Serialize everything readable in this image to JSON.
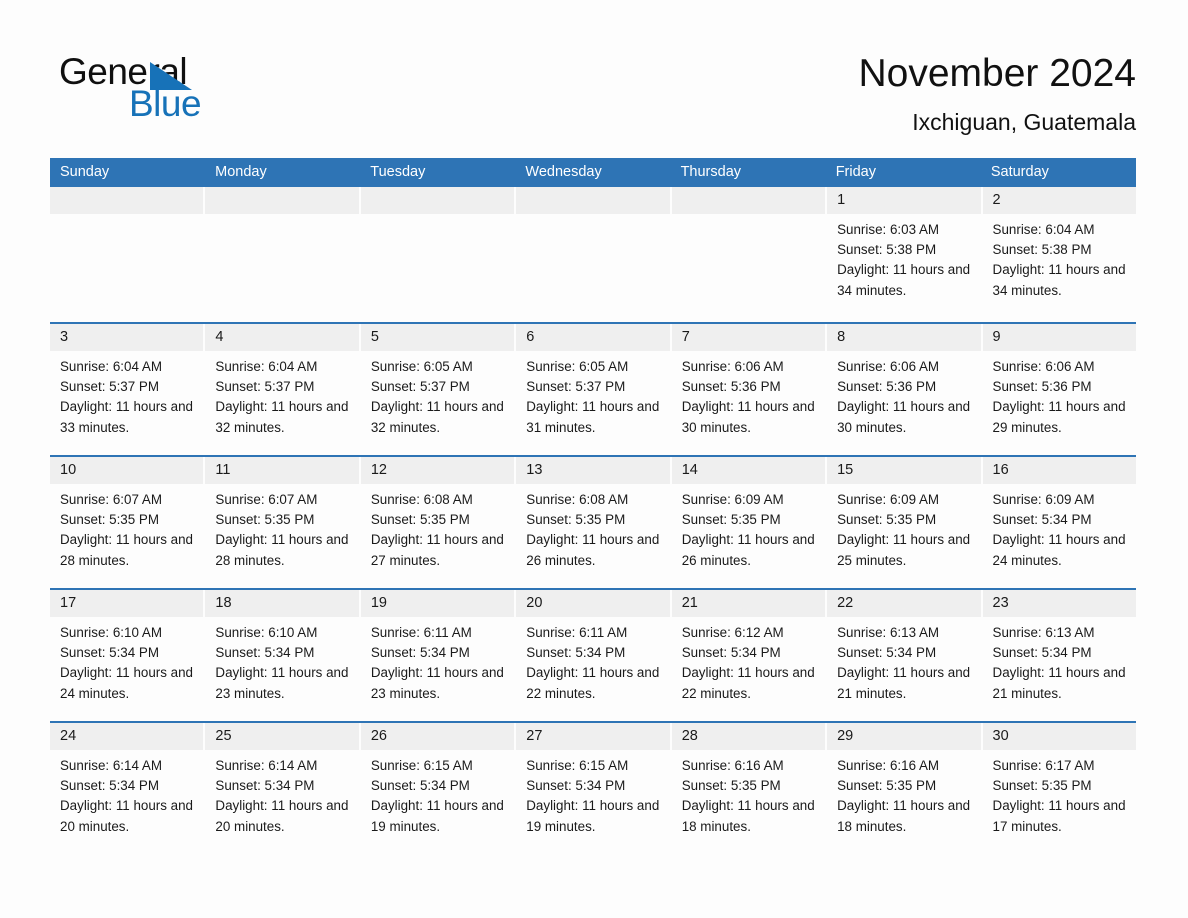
{
  "brand": {
    "name_top": "General",
    "name_bottom": "Blue",
    "accent_color": "#1772b8"
  },
  "header": {
    "title": "November 2024",
    "subtitle": "Ixchiguan, Guatemala"
  },
  "theme": {
    "header_blue": "#2e74b5",
    "day_band_gray": "#efefef",
    "page_background": "#fdfdfd",
    "text_color": "#1a1a1a"
  },
  "weekdays": [
    "Sunday",
    "Monday",
    "Tuesday",
    "Wednesday",
    "Thursday",
    "Friday",
    "Saturday"
  ],
  "weeks": [
    [
      {
        "day": "",
        "sunrise": "",
        "sunset": "",
        "daylight": ""
      },
      {
        "day": "",
        "sunrise": "",
        "sunset": "",
        "daylight": ""
      },
      {
        "day": "",
        "sunrise": "",
        "sunset": "",
        "daylight": ""
      },
      {
        "day": "",
        "sunrise": "",
        "sunset": "",
        "daylight": ""
      },
      {
        "day": "",
        "sunrise": "",
        "sunset": "",
        "daylight": ""
      },
      {
        "day": "1",
        "sunrise": "Sunrise: 6:03 AM",
        "sunset": "Sunset: 5:38 PM",
        "daylight": "Daylight: 11 hours and 34 minutes."
      },
      {
        "day": "2",
        "sunrise": "Sunrise: 6:04 AM",
        "sunset": "Sunset: 5:38 PM",
        "daylight": "Daylight: 11 hours and 34 minutes."
      }
    ],
    [
      {
        "day": "3",
        "sunrise": "Sunrise: 6:04 AM",
        "sunset": "Sunset: 5:37 PM",
        "daylight": "Daylight: 11 hours and 33 minutes."
      },
      {
        "day": "4",
        "sunrise": "Sunrise: 6:04 AM",
        "sunset": "Sunset: 5:37 PM",
        "daylight": "Daylight: 11 hours and 32 minutes."
      },
      {
        "day": "5",
        "sunrise": "Sunrise: 6:05 AM",
        "sunset": "Sunset: 5:37 PM",
        "daylight": "Daylight: 11 hours and 32 minutes."
      },
      {
        "day": "6",
        "sunrise": "Sunrise: 6:05 AM",
        "sunset": "Sunset: 5:37 PM",
        "daylight": "Daylight: 11 hours and 31 minutes."
      },
      {
        "day": "7",
        "sunrise": "Sunrise: 6:06 AM",
        "sunset": "Sunset: 5:36 PM",
        "daylight": "Daylight: 11 hours and 30 minutes."
      },
      {
        "day": "8",
        "sunrise": "Sunrise: 6:06 AM",
        "sunset": "Sunset: 5:36 PM",
        "daylight": "Daylight: 11 hours and 30 minutes."
      },
      {
        "day": "9",
        "sunrise": "Sunrise: 6:06 AM",
        "sunset": "Sunset: 5:36 PM",
        "daylight": "Daylight: 11 hours and 29 minutes."
      }
    ],
    [
      {
        "day": "10",
        "sunrise": "Sunrise: 6:07 AM",
        "sunset": "Sunset: 5:35 PM",
        "daylight": "Daylight: 11 hours and 28 minutes."
      },
      {
        "day": "11",
        "sunrise": "Sunrise: 6:07 AM",
        "sunset": "Sunset: 5:35 PM",
        "daylight": "Daylight: 11 hours and 28 minutes."
      },
      {
        "day": "12",
        "sunrise": "Sunrise: 6:08 AM",
        "sunset": "Sunset: 5:35 PM",
        "daylight": "Daylight: 11 hours and 27 minutes."
      },
      {
        "day": "13",
        "sunrise": "Sunrise: 6:08 AM",
        "sunset": "Sunset: 5:35 PM",
        "daylight": "Daylight: 11 hours and 26 minutes."
      },
      {
        "day": "14",
        "sunrise": "Sunrise: 6:09 AM",
        "sunset": "Sunset: 5:35 PM",
        "daylight": "Daylight: 11 hours and 26 minutes."
      },
      {
        "day": "15",
        "sunrise": "Sunrise: 6:09 AM",
        "sunset": "Sunset: 5:35 PM",
        "daylight": "Daylight: 11 hours and 25 minutes."
      },
      {
        "day": "16",
        "sunrise": "Sunrise: 6:09 AM",
        "sunset": "Sunset: 5:34 PM",
        "daylight": "Daylight: 11 hours and 24 minutes."
      }
    ],
    [
      {
        "day": "17",
        "sunrise": "Sunrise: 6:10 AM",
        "sunset": "Sunset: 5:34 PM",
        "daylight": "Daylight: 11 hours and 24 minutes."
      },
      {
        "day": "18",
        "sunrise": "Sunrise: 6:10 AM",
        "sunset": "Sunset: 5:34 PM",
        "daylight": "Daylight: 11 hours and 23 minutes."
      },
      {
        "day": "19",
        "sunrise": "Sunrise: 6:11 AM",
        "sunset": "Sunset: 5:34 PM",
        "daylight": "Daylight: 11 hours and 23 minutes."
      },
      {
        "day": "20",
        "sunrise": "Sunrise: 6:11 AM",
        "sunset": "Sunset: 5:34 PM",
        "daylight": "Daylight: 11 hours and 22 minutes."
      },
      {
        "day": "21",
        "sunrise": "Sunrise: 6:12 AM",
        "sunset": "Sunset: 5:34 PM",
        "daylight": "Daylight: 11 hours and 22 minutes."
      },
      {
        "day": "22",
        "sunrise": "Sunrise: 6:13 AM",
        "sunset": "Sunset: 5:34 PM",
        "daylight": "Daylight: 11 hours and 21 minutes."
      },
      {
        "day": "23",
        "sunrise": "Sunrise: 6:13 AM",
        "sunset": "Sunset: 5:34 PM",
        "daylight": "Daylight: 11 hours and 21 minutes."
      }
    ],
    [
      {
        "day": "24",
        "sunrise": "Sunrise: 6:14 AM",
        "sunset": "Sunset: 5:34 PM",
        "daylight": "Daylight: 11 hours and 20 minutes."
      },
      {
        "day": "25",
        "sunrise": "Sunrise: 6:14 AM",
        "sunset": "Sunset: 5:34 PM",
        "daylight": "Daylight: 11 hours and 20 minutes."
      },
      {
        "day": "26",
        "sunrise": "Sunrise: 6:15 AM",
        "sunset": "Sunset: 5:34 PM",
        "daylight": "Daylight: 11 hours and 19 minutes."
      },
      {
        "day": "27",
        "sunrise": "Sunrise: 6:15 AM",
        "sunset": "Sunset: 5:34 PM",
        "daylight": "Daylight: 11 hours and 19 minutes."
      },
      {
        "day": "28",
        "sunrise": "Sunrise: 6:16 AM",
        "sunset": "Sunset: 5:35 PM",
        "daylight": "Daylight: 11 hours and 18 minutes."
      },
      {
        "day": "29",
        "sunrise": "Sunrise: 6:16 AM",
        "sunset": "Sunset: 5:35 PM",
        "daylight": "Daylight: 11 hours and 18 minutes."
      },
      {
        "day": "30",
        "sunrise": "Sunrise: 6:17 AM",
        "sunset": "Sunset: 5:35 PM",
        "daylight": "Daylight: 11 hours and 17 minutes."
      }
    ]
  ]
}
